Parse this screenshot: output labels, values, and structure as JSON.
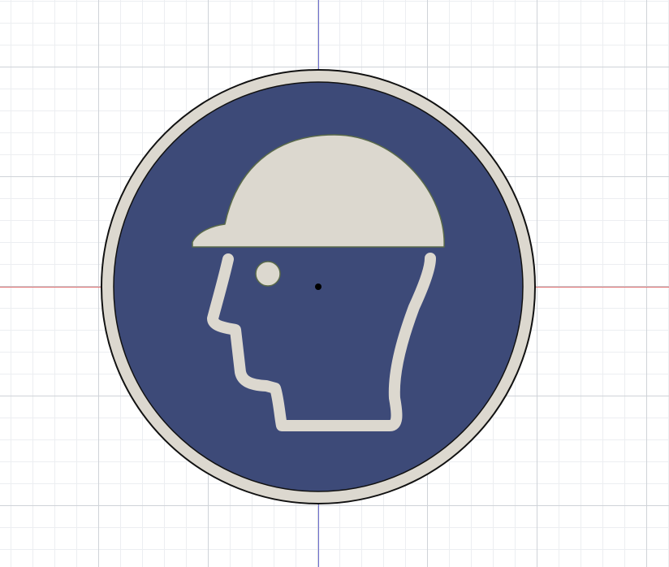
{
  "canvas": {
    "grid_major_color": "#cfd3d8",
    "grid_minor_color": "#eceef1",
    "background_color": "#ffffff",
    "x_axis_color": "#e07070",
    "y_axis_color": "#7070d0"
  },
  "sign": {
    "type": "mandatory-head-protection",
    "field_color": "#3d4a78",
    "symbol_color": "#dcd8cf",
    "rim_color": "#dcd8cf",
    "outline_color": "#111111",
    "origin_marker_color": "#000000",
    "icons": [
      "hard-hat-icon",
      "head-profile-icon"
    ]
  }
}
